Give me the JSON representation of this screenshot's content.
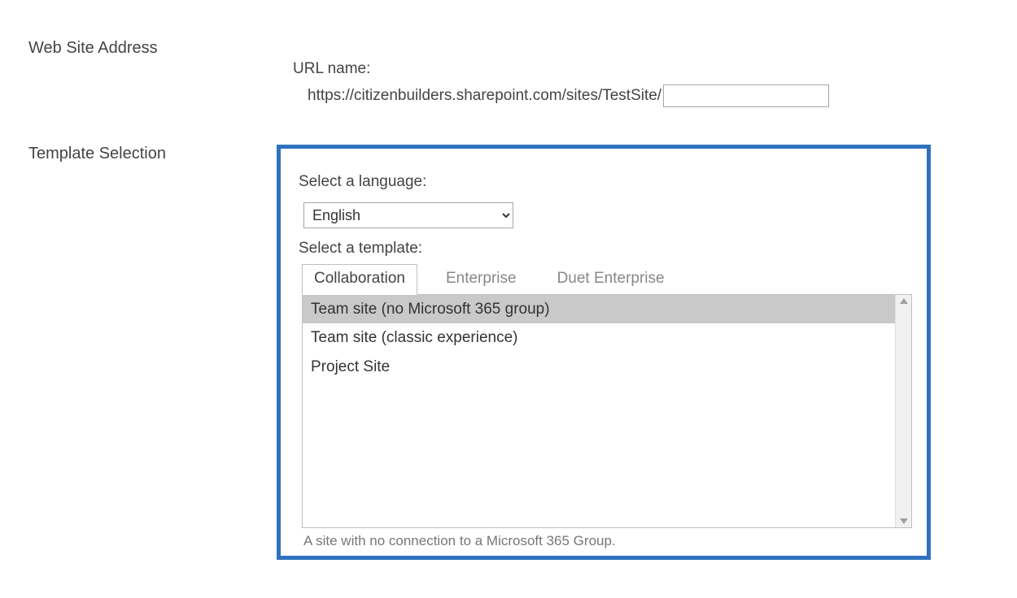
{
  "sections": {
    "web_site_address_label": "Web Site Address",
    "template_selection_label": "Template Selection"
  },
  "address": {
    "url_name_label": "URL name:",
    "base_url": "https://citizenbuilders.sharepoint.com/sites/TestSite/",
    "url_value": ""
  },
  "template": {
    "language_label": "Select a language:",
    "language_selected": "English",
    "template_label": "Select a template:",
    "tabs": [
      {
        "label": "Collaboration",
        "active": true
      },
      {
        "label": "Enterprise",
        "active": false
      },
      {
        "label": "Duet Enterprise",
        "active": false
      }
    ],
    "items": [
      {
        "label": "Team site (no Microsoft 365 group)",
        "selected": true
      },
      {
        "label": "Team site (classic experience)",
        "selected": false
      },
      {
        "label": "Project Site",
        "selected": false
      }
    ],
    "description": "A site with no connection to a Microsoft 365 Group."
  },
  "colors": {
    "highlight_border": "#2f71c0"
  }
}
